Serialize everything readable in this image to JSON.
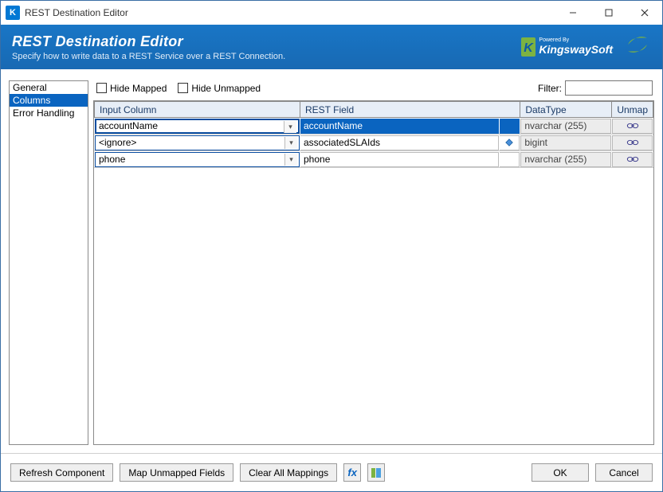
{
  "window": {
    "title": "REST Destination Editor"
  },
  "banner": {
    "title": "REST Destination Editor",
    "subtitle": "Specify how to write data to a REST Service over a REST Connection."
  },
  "sidebar": {
    "items": [
      {
        "label": "General"
      },
      {
        "label": "Columns"
      },
      {
        "label": "Error Handling"
      }
    ]
  },
  "toolbar": {
    "hide_mapped": "Hide Mapped",
    "hide_unmapped": "Hide Unmapped",
    "filter_label": "Filter:",
    "filter_value": ""
  },
  "table": {
    "headers": {
      "input_column": "Input Column",
      "rest_field": "REST Field",
      "datatype": "DataType",
      "unmap": "Unmap"
    },
    "rows": [
      {
        "input": "accountName",
        "rest": "accountName",
        "datatype": "nvarchar (255)",
        "link_icon": false,
        "selected": true
      },
      {
        "input": "<ignore>",
        "rest": "associatedSLAIds",
        "datatype": "bigint",
        "link_icon": true,
        "selected": false
      },
      {
        "input": "phone",
        "rest": "phone",
        "datatype": "nvarchar (255)",
        "link_icon": false,
        "selected": false
      }
    ]
  },
  "footer": {
    "refresh": "Refresh Component",
    "map_unmapped": "Map Unmapped Fields",
    "clear_all": "Clear All Mappings",
    "ok": "OK",
    "cancel": "Cancel"
  }
}
